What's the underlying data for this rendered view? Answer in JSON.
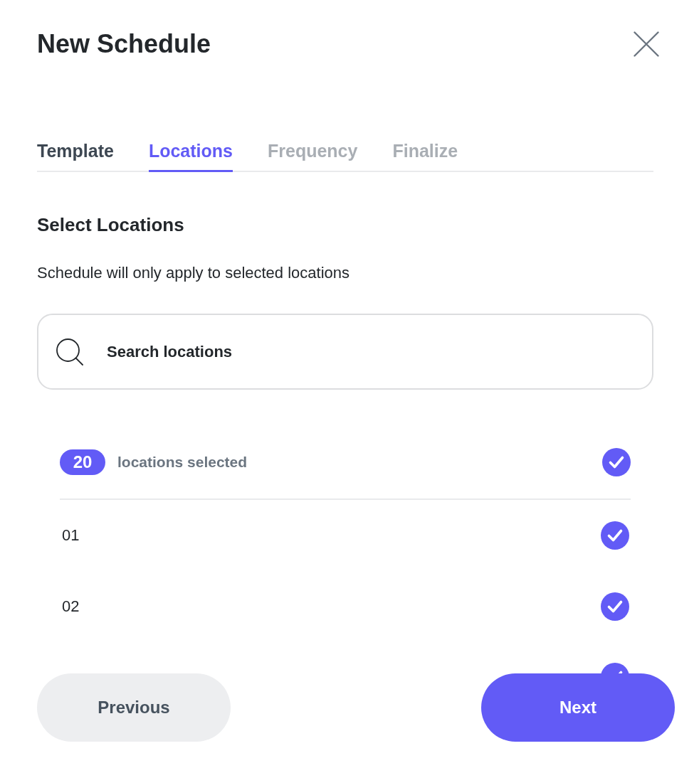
{
  "dialog": {
    "title": "New Schedule"
  },
  "tabs": [
    {
      "label": "Template",
      "selected": false,
      "disabled": false
    },
    {
      "label": "Locations",
      "selected": true,
      "disabled": false
    },
    {
      "label": "Frequency",
      "selected": false,
      "disabled": true
    },
    {
      "label": "Finalize",
      "selected": false,
      "disabled": true
    }
  ],
  "section": {
    "heading": "Select Locations",
    "description": "Schedule will only apply to selected locations"
  },
  "search": {
    "placeholder": "Search locations"
  },
  "selection": {
    "count": "20",
    "label": "locations selected",
    "all_checked": true
  },
  "locations": [
    {
      "label": "01",
      "checked": true
    },
    {
      "label": "02",
      "checked": true
    },
    {
      "checked": true
    }
  ],
  "buttons": [
    {
      "label": "Previous",
      "kind": "secondary"
    },
    {
      "label": "Next",
      "kind": "primary"
    }
  ]
}
